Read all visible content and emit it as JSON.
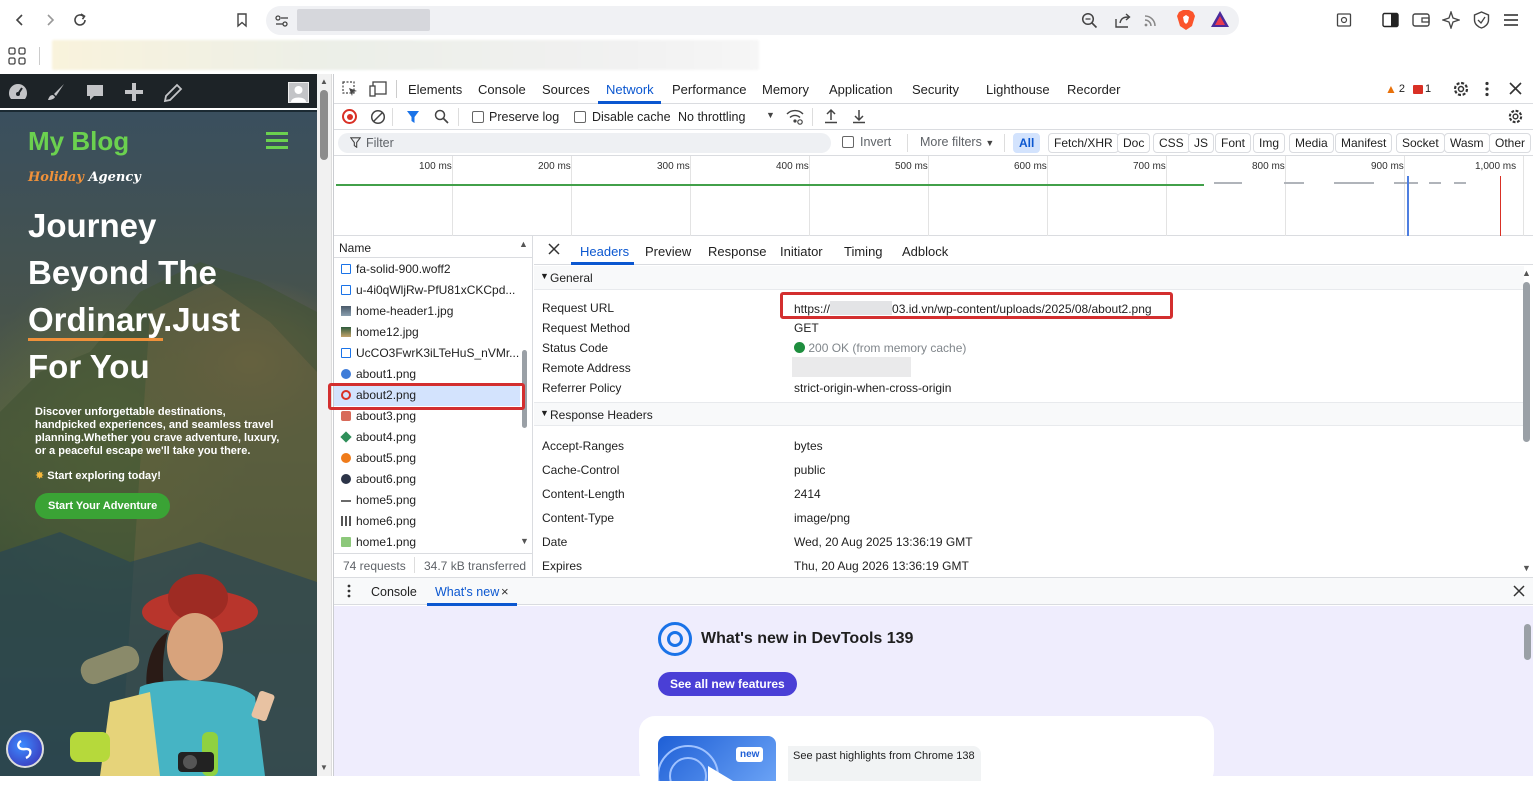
{
  "browser": {
    "back_icon": "chevron-left-icon",
    "forward_icon": "chevron-right-icon",
    "reload_icon": "reload-icon",
    "bookmark_icon": "bookmark-icon"
  },
  "page": {
    "brand": "My Blog",
    "logo_text_1": "Holiday",
    "logo_text_2": "Agency",
    "hero_line1": "Journey",
    "hero_line2": "Beyond The",
    "hero_line3a": "Ordinary",
    "hero_line3b": ".Just",
    "hero_line4": "For You",
    "description": "Discover unforgettable destinations, handpicked experiences, and seamless travel planning.Whether you crave adventure, luxury, or a peaceful escape we'll take you there.",
    "cta_hint": "Start exploring today!",
    "cta_button": "Start Your Adventure"
  },
  "devtools": {
    "tabs": [
      "Elements",
      "Console",
      "Sources",
      "Network",
      "Performance",
      "Memory",
      "Application",
      "Security",
      "Lighthouse",
      "Recorder"
    ],
    "active_tab": "Network",
    "warnings_count": "2",
    "errors_count": "1",
    "toolbar": {
      "preserve_log": "Preserve log",
      "disable_cache": "Disable cache",
      "throttling": "No throttling"
    },
    "filter": {
      "placeholder": "Filter",
      "invert": "Invert",
      "more_filters": "More filters",
      "types": [
        "All",
        "Fetch/XHR",
        "Doc",
        "CSS",
        "JS",
        "Font",
        "Img",
        "Media",
        "Manifest",
        "Socket",
        "Wasm",
        "Other"
      ],
      "active_type": "All"
    },
    "timeline_ticks": [
      "100 ms",
      "200 ms",
      "300 ms",
      "400 ms",
      "500 ms",
      "600 ms",
      "700 ms",
      "800 ms",
      "900 ms",
      "1,000 ms"
    ],
    "request_list": {
      "header": "Name",
      "items": [
        {
          "name": "fa-solid-900.woff2",
          "icon": "font-file-icon"
        },
        {
          "name": "u-4i0qWljRw-PfU81xCKCpd...",
          "icon": "font-file-icon"
        },
        {
          "name": "home-header1.jpg",
          "icon": "image-file-icon"
        },
        {
          "name": "home12.jpg",
          "icon": "image-file-icon"
        },
        {
          "name": "UcCO3FwrK3iLTeHuS_nVMr...",
          "icon": "font-file-icon"
        },
        {
          "name": "about1.png",
          "icon": "image-file-icon"
        },
        {
          "name": "about2.png",
          "icon": "image-file-icon"
        },
        {
          "name": "about3.png",
          "icon": "image-file-icon"
        },
        {
          "name": "about4.png",
          "icon": "image-file-icon"
        },
        {
          "name": "about5.png",
          "icon": "image-file-icon"
        },
        {
          "name": "about6.png",
          "icon": "image-file-icon"
        },
        {
          "name": "home5.png",
          "icon": "image-file-icon"
        },
        {
          "name": "home6.png",
          "icon": "image-file-icon"
        },
        {
          "name": "home1.png",
          "icon": "image-file-icon"
        }
      ],
      "selected": "about2.png",
      "requests_summary": "74 requests",
      "transferred_summary": "34.7 kB transferred"
    },
    "detail": {
      "tabs": [
        "Headers",
        "Preview",
        "Response",
        "Initiator",
        "Timing",
        "Adblock"
      ],
      "active_tab": "Headers",
      "general_title": "General",
      "general": [
        {
          "key": "Request URL",
          "value_prefix": "https://",
          "value_suffix": "03.id.vn/wp-content/uploads/2025/08/about2.png"
        },
        {
          "key": "Request Method",
          "value": "GET"
        },
        {
          "key": "Status Code",
          "value": "200 OK (from memory cache)"
        },
        {
          "key": "Remote Address",
          "value": ""
        },
        {
          "key": "Referrer Policy",
          "value": "strict-origin-when-cross-origin"
        }
      ],
      "response_title": "Response Headers",
      "response_headers": [
        {
          "key": "Accept-Ranges",
          "value": "bytes"
        },
        {
          "key": "Cache-Control",
          "value": "public"
        },
        {
          "key": "Content-Length",
          "value": "2414"
        },
        {
          "key": "Content-Type",
          "value": "image/png"
        },
        {
          "key": "Date",
          "value": "Wed, 20 Aug 2025 13:36:19 GMT"
        },
        {
          "key": "Expires",
          "value": "Thu, 20 Aug 2026 13:36:19 GMT"
        }
      ]
    },
    "drawer": {
      "tabs": [
        "Console",
        "What's new"
      ],
      "active_tab": "What's new",
      "title": "What's new in DevTools 139",
      "button": "See all new features",
      "card_badge": "new",
      "card_text": "See past highlights from Chrome 138"
    }
  },
  "colors": {
    "accent_blue": "#1a73e8",
    "devtools_active": "#0b57d0",
    "highlight_red": "#d32f2f",
    "status_green": "#1e8e3e",
    "brand_green": "#6bd14f",
    "cta_green": "#3aa335",
    "wn_purple": "#4a3fd6"
  }
}
